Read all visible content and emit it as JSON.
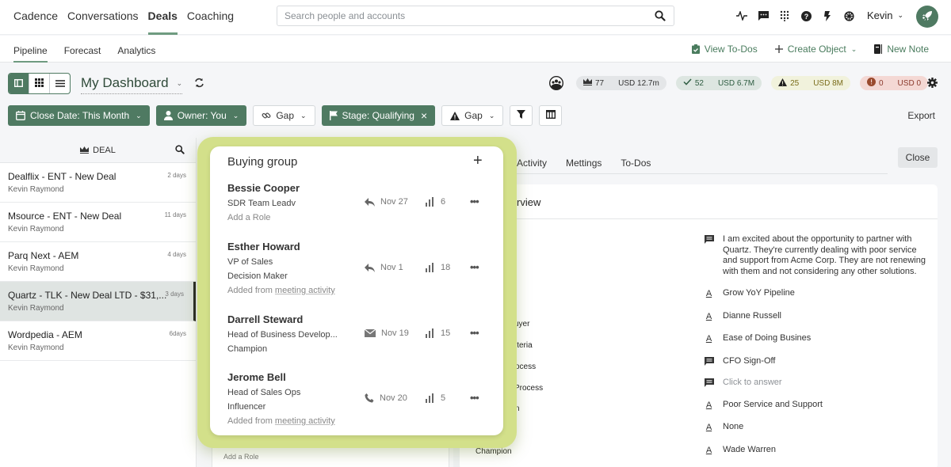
{
  "topnav": {
    "items": [
      "Cadence",
      "Conversations",
      "Deals",
      "Coaching"
    ],
    "active": "Deals",
    "search_placeholder": "Search people and accounts",
    "icons": [
      "activity-icon",
      "chat-icon",
      "apps-grid-icon",
      "help-icon",
      "lightning-icon",
      "settings-wheel-icon"
    ],
    "user_name": "Kevin",
    "brand_color": "#4f7a62"
  },
  "subnav": {
    "items": [
      "Pipeline",
      "Forecast",
      "Analytics"
    ],
    "active": "Pipeline",
    "actions": {
      "view_todos": "View To-Dos",
      "create_object": "Create Object",
      "new_note": "New Note"
    }
  },
  "dashboard": {
    "title": "My Dashboard",
    "stats": [
      {
        "icon": "crown-icon",
        "count": "77",
        "amount": "USD 12.7m",
        "tone": "grey"
      },
      {
        "icon": "check-icon",
        "count": "52",
        "amount": "USD 6.7M",
        "tone": "green"
      },
      {
        "icon": "warning-icon",
        "count": "25",
        "amount": "USD 8M",
        "tone": "yellow"
      },
      {
        "icon": "alert-circle-icon",
        "count": "0",
        "amount": "USD 0",
        "tone": "red"
      }
    ]
  },
  "filters": {
    "close_date": "Close Date: This Month",
    "owner": "Owner: You",
    "gap1": "Gap",
    "stage": "Stage: Qualifying",
    "gap2": "Gap",
    "export": "Export"
  },
  "deals": {
    "header": "DEAL",
    "items": [
      {
        "name": "Dealflix - ENT - New Deal",
        "owner": "Kevin Raymond",
        "age": "2 days"
      },
      {
        "name": "Msource - ENT - New Deal",
        "owner": "Kevin Raymond",
        "age": "11 days"
      },
      {
        "name": "Parq Next - AEM",
        "owner": "Kevin Raymond",
        "age": "4 days"
      },
      {
        "name": "Quartz - TLK - New Deal LTD - $31,...",
        "owner": "Kevin Raymond",
        "age": "3 days",
        "selected": true
      },
      {
        "name": "Wordpedia - AEM",
        "owner": "Kevin Raymond",
        "age": "6days"
      }
    ]
  },
  "detail": {
    "tabs": [
      "Activity",
      "Mettings",
      "To-Dos"
    ],
    "close": "Close",
    "overview_title": "rview",
    "question_labels": [
      "uyer",
      "iteria",
      "ocess",
      "Process",
      "n",
      "Champion"
    ],
    "answers": [
      {
        "icon": "comment-icon",
        "text": "I am excited about the opportunity to partner with Quartz. They're currently dealing with poor service and support from Acme Corp. They are not renewing with them and not considering any other solutions."
      },
      {
        "icon": "text-answer-icon",
        "text": "Grow YoY Pipeline"
      },
      {
        "icon": "text-answer-icon",
        "text": "Dianne Russell"
      },
      {
        "icon": "text-answer-icon",
        "text": "Ease of Doing Busines"
      },
      {
        "icon": "comment-icon",
        "text": "CFO Sign-Off"
      },
      {
        "icon": "comment-icon",
        "text": "Click to answer",
        "muted": true
      },
      {
        "icon": "text-answer-icon",
        "text": "Poor Service and Support"
      },
      {
        "icon": "text-answer-icon",
        "text": "None"
      },
      {
        "icon": "text-answer-icon",
        "text": "Wade Warren"
      }
    ],
    "add_role_behind": "Add a Role"
  },
  "buying_group": {
    "title": "Buying group",
    "add_label": "+",
    "members": [
      {
        "name": "Bessie Cooper",
        "lines": [
          "SDR Team Leadv"
        ],
        "note": "Add a Role",
        "activity_icon": "reply-icon",
        "date": "Nov 27",
        "score": "6"
      },
      {
        "name": "Esther Howard",
        "lines": [
          "VP of Sales",
          "Decision Maker"
        ],
        "note_prefix": "Added from ",
        "note_link": "meeting activity",
        "activity_icon": "reply-icon",
        "date": "Nov 1",
        "score": "18"
      },
      {
        "name": "Darrell Steward",
        "lines": [
          "Head of Business Develop...",
          "Champion"
        ],
        "activity_icon": "mail-icon",
        "date": "Nov 19",
        "score": "15"
      },
      {
        "name": "Jerome Bell",
        "lines": [
          "Head of Sales Ops",
          "Influencer"
        ],
        "note_prefix": "Added from ",
        "note_link": "meeting activity",
        "activity_icon": "phone-icon",
        "date": "Nov 20",
        "score": "5"
      }
    ],
    "highlight_color": "#d3e08a"
  }
}
